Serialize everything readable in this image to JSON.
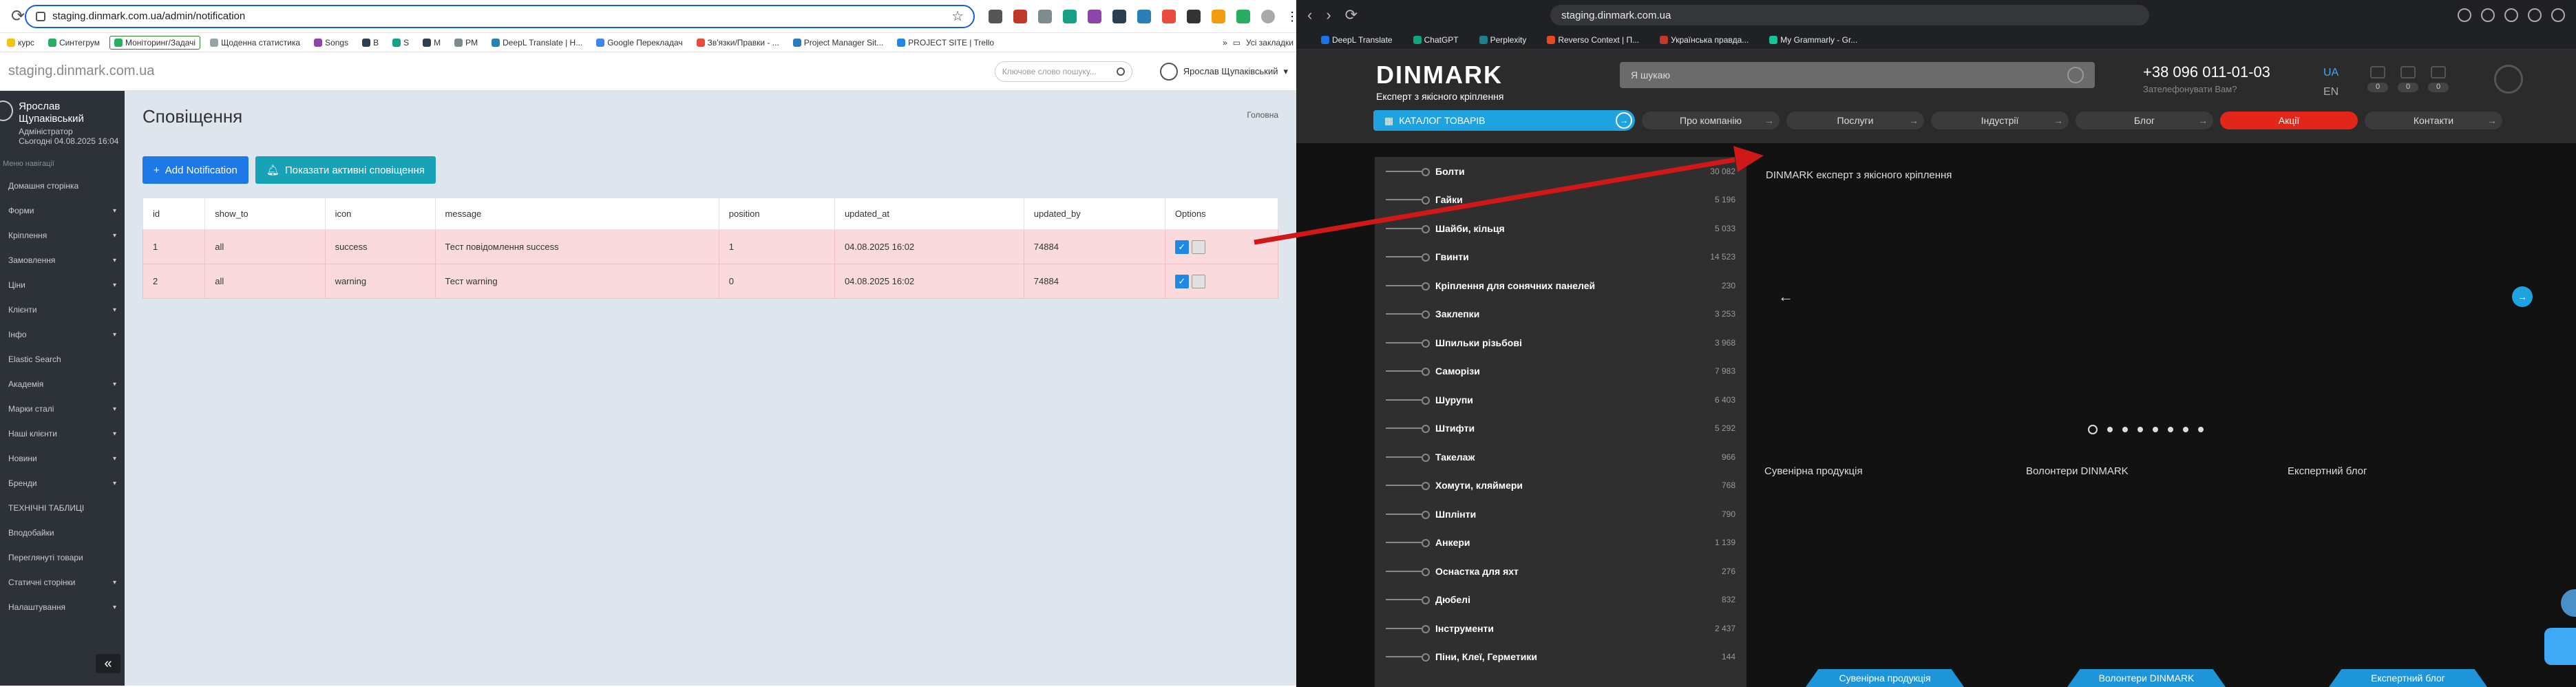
{
  "left": {
    "url": "staging.dinmark.com.ua/admin/notification",
    "bookmarks": [
      "курс",
      "Синтегрум",
      "Моніторинг/Задачі",
      "Щоденна статистика",
      "Songs",
      "B",
      "S",
      "M",
      "PM",
      "DeepL Translate | Н...",
      "Google Перекладач",
      "Зв'язки/Правки - ...",
      "Project Manager Sit...",
      "PROJECT SITE | Trello"
    ],
    "bookmarks_more": "»",
    "bookmarks_all": "Усі закладки",
    "site_name": "staging.dinmark.com.ua",
    "search_placeholder": "Ключове слово пошуку...",
    "user_name": "Ярослав Щупаківський",
    "sidebar": {
      "user_name": "Ярослав Щупаківський",
      "role": "Адміністратор",
      "last_seen": "Сьогодні 04.08.2025 16:04",
      "nav_heading": "Меню навігації",
      "items": [
        {
          "label": "Домашня сторінка",
          "chev": false
        },
        {
          "label": "Форми",
          "chev": true
        },
        {
          "label": "Кріплення",
          "chev": true
        },
        {
          "label": "Замовлення",
          "chev": true
        },
        {
          "label": "Ціни",
          "chev": true
        },
        {
          "label": "Клієнти",
          "chev": true
        },
        {
          "label": "Інфо",
          "chev": true
        },
        {
          "label": "Elastic Search",
          "chev": false
        },
        {
          "label": "Академія",
          "chev": true
        },
        {
          "label": "Марки сталі",
          "chev": true
        },
        {
          "label": "Наші клієнти",
          "chev": true
        },
        {
          "label": "Новини",
          "chev": true
        },
        {
          "label": "Бренди",
          "chev": true
        },
        {
          "label": "ТЕХНІЧНІ ТАБЛИЦІ",
          "chev": false
        },
        {
          "label": "Вподобайки",
          "chev": false
        },
        {
          "label": "Переглянуті товари",
          "chev": false
        },
        {
          "label": "Статичні сторінки",
          "chev": true
        },
        {
          "label": "Налаштування",
          "chev": true
        }
      ],
      "collapse": "«"
    },
    "page_title": "Сповіщення",
    "breadcrumb": "Головна",
    "add_button": "Add Notification",
    "show_active_button": "Показати активні сповіщення",
    "table": {
      "headers": [
        "id",
        "show_to",
        "icon",
        "message",
        "position",
        "updated_at",
        "updated_by",
        "Options"
      ],
      "rows": [
        [
          "1",
          "all",
          "success",
          "Тест повідомлення success",
          "1",
          "04.08.2025 16:02",
          "74884"
        ],
        [
          "2",
          "all",
          "warning",
          "Тест warning",
          "0",
          "04.08.2025 16:02",
          "74884"
        ]
      ]
    }
  },
  "right": {
    "url": "staging.dinmark.com.ua",
    "bookmarks": [
      "DeepL Translate",
      "ChatGPT",
      "Perplexity",
      "Reverso Context | П...",
      "Українська правда...",
      "My Grammarly - Gr..."
    ],
    "logo_title": "DINMARK",
    "logo_tagline": "Експерт з якісного кріплення",
    "search_placeholder": "Я шукаю",
    "phone": "+38 096 011-01-03",
    "phone_sub": "Зателефонувати Вам?",
    "lang_active": "UA",
    "lang_other": "EN",
    "icon_counts": [
      "0",
      "0",
      "0"
    ],
    "catalog_button": "КАТАЛОГ ТОВАРІВ",
    "nav": [
      {
        "label": "Про компанію",
        "red": false
      },
      {
        "label": "Послуги",
        "red": false
      },
      {
        "label": "Індустрії",
        "red": false
      },
      {
        "label": "Блог",
        "red": false
      },
      {
        "label": "Акції",
        "red": true
      },
      {
        "label": "Контакти",
        "red": false
      }
    ],
    "catalog": [
      {
        "name": "Болти",
        "count": "30 082"
      },
      {
        "name": "Гайки",
        "count": "5 196"
      },
      {
        "name": "Шайби, кільця",
        "count": "5 033"
      },
      {
        "name": "Гвинти",
        "count": "14 523"
      },
      {
        "name": "Кріплення для сонячних панелей",
        "count": "230"
      },
      {
        "name": "Заклепки",
        "count": "3 253"
      },
      {
        "name": "Шпильки різьбові",
        "count": "3 968"
      },
      {
        "name": "Саморізи",
        "count": "7 983"
      },
      {
        "name": "Шурупи",
        "count": "6 403"
      },
      {
        "name": "Штифти",
        "count": "5 292"
      },
      {
        "name": "Такелаж",
        "count": "966"
      },
      {
        "name": "Хомути, кляймери",
        "count": "768"
      },
      {
        "name": "Шплінти",
        "count": "790"
      },
      {
        "name": "Анкери",
        "count": "1 139"
      },
      {
        "name": "Оснастка для яхт",
        "count": "276"
      },
      {
        "name": "Дюбелі",
        "count": "832"
      },
      {
        "name": "Інструменти",
        "count": "2 437"
      },
      {
        "name": "Піни, Клеї, Герметики",
        "count": "144"
      }
    ],
    "slider_alt": "DINMARK експерт з якісного кріплення",
    "slider_prev": "←",
    "slider_next": "→",
    "slider_dot_count": 8,
    "tiles": [
      {
        "alt": "Сувенірна продукція",
        "label": "Сувенірна продукція"
      },
      {
        "alt": "Волонтери DINMARK",
        "label": "Волонтери DINMARK"
      },
      {
        "alt": "Експертний блог",
        "label": "Експертний блог"
      }
    ]
  },
  "colors": {
    "admin_sidebar": "#2d3238",
    "admin_content": "#dfe5ec",
    "row_highlight": "#fadadd",
    "primary_blue": "#1e79e6",
    "teal": "#17a2b8",
    "site_accent": "#1ea2e0",
    "promo_red": "#e2271a",
    "arrow_red": "#d01818"
  }
}
